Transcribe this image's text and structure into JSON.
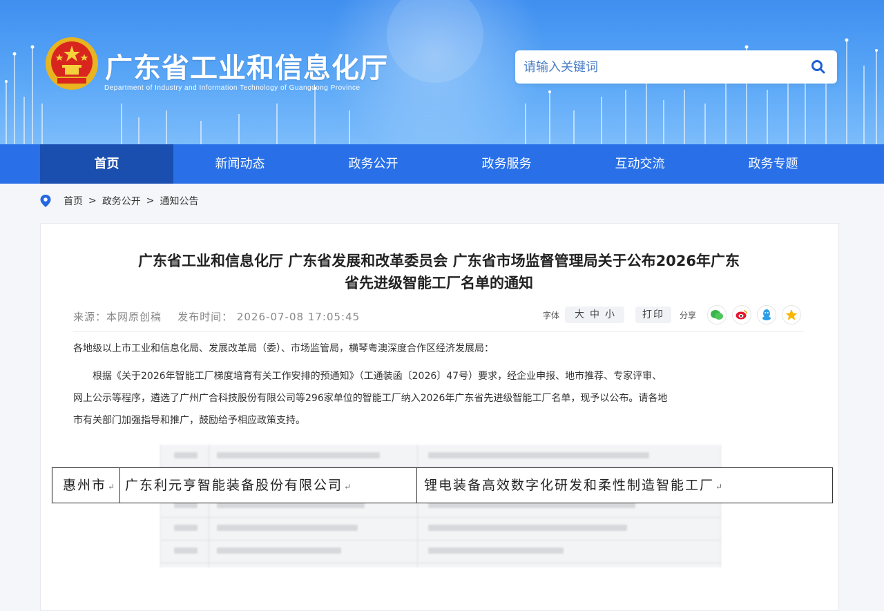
{
  "header": {
    "site_title": "广东省工业和信息化厅",
    "site_subtitle": "Department of Industry and Information Technology of Guangdong Province",
    "search_placeholder": "请输入关键词"
  },
  "nav": {
    "items": [
      {
        "label": "首页",
        "active": true
      },
      {
        "label": "新闻动态"
      },
      {
        "label": "政务公开"
      },
      {
        "label": "政务服务"
      },
      {
        "label": "互动交流"
      },
      {
        "label": "政务专题"
      }
    ]
  },
  "breadcrumb": [
    "首页",
    "政务公开",
    "通知公告"
  ],
  "breadcrumb_sep": ">",
  "article": {
    "title_line1": "广东省工业和信息化厅 广东省发展和改革委员会 广东省市场监督管理局关于公布2026年广东",
    "title_line2": "省先进级智能工厂名单的通知",
    "source": "来源：本网原创稿",
    "publish_time": "发布时间： 2026-07-08 17:05:45",
    "font_label": "字体",
    "font_large": "大",
    "font_medium": "中",
    "font_small": "小",
    "print_label": "打印",
    "share_label": "分享",
    "share_icons": [
      "wechat-icon",
      "weibo-icon",
      "qq-icon",
      "qzone-icon"
    ],
    "salutation": "各地级以上市工业和信息化局、发展改革局（委）、市场监管局，横琴粤澳深度合作区经济发展局：",
    "body_line1": "根据《关于2026年智能工厂梯度培育有关工作安排的预通知》（工通装函〔2026〕47号）要求，经企业申报、地市推荐、专家评审、",
    "body_line2": "网上公示等程序，遴选了广州广合科技股份有限公司等296家单位的智能工厂纳入2026年广东省先进级智能工厂名单，现予以公布。请各地",
    "body_line3": "市有关部门加强指导和推广，鼓励给予相应政策支持。"
  },
  "table_highlight": {
    "city": "惠州市",
    "company": "广东利元亨智能装备股份有限公司",
    "factory": "锂电装备高效数字化研发和柔性制造智能工厂",
    "return_mark": "↵"
  },
  "colors": {
    "nav_bg": "#2970e8",
    "nav_active": "#1a4fb0",
    "header_blue": "#3f8ff0"
  }
}
